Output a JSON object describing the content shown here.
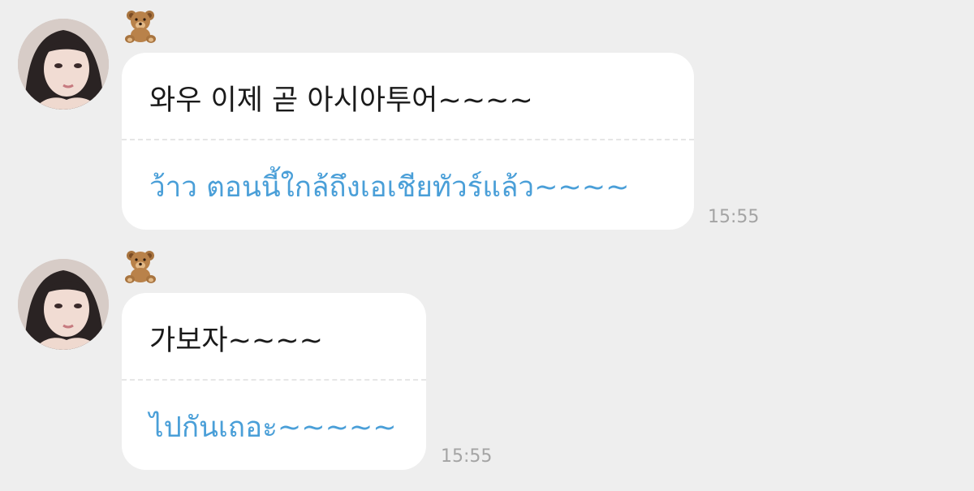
{
  "messages": [
    {
      "sender_emoji": "🧸",
      "original": "와우 이제 곧 아시아투어~~~~",
      "translation": "ว้าว ตอนนี้ใกล้ถึงเอเชียทัวร์แล้ว~~~~",
      "time": "15:55"
    },
    {
      "sender_emoji": "🧸",
      "original": "가보자~~~~",
      "translation": "ไปกันเถอะ~~~~~",
      "time": "15:55"
    }
  ],
  "colors": {
    "background": "#eeeeee",
    "bubble": "#ffffff",
    "translation_text": "#4a9fd8",
    "timestamp": "#a4a4a4"
  },
  "icons": {
    "sender_badge": "teddy-bear-icon",
    "avatar": "user-avatar"
  }
}
